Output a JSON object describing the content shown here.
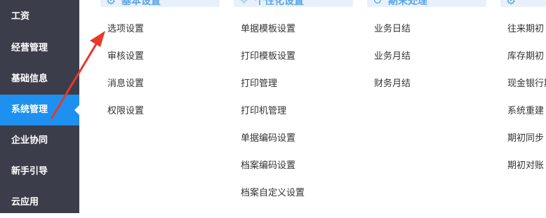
{
  "sidebar": {
    "items": [
      {
        "label": "工资"
      },
      {
        "label": "经营管理"
      },
      {
        "label": "基础信息"
      },
      {
        "label": "系统管理"
      },
      {
        "label": "企业协同"
      },
      {
        "label": "新手引导"
      },
      {
        "label": "云应用"
      }
    ],
    "active_index": 3
  },
  "columns": [
    {
      "header": "基本设置",
      "icon": "gear-icon",
      "items": [
        "选项设置",
        "审核设置",
        "消息设置",
        "权限设置"
      ]
    },
    {
      "header": "个性化设置",
      "icon": "star-icon",
      "items": [
        "单据模板设置",
        "打印模板设置",
        "打印管理",
        "打印机管理",
        "单据编码设置",
        "档案编码设置",
        "档案自定义设置"
      ]
    },
    {
      "header": "期末处理",
      "icon": "cycle-icon",
      "items": [
        "业务日结",
        "业务月结",
        "财务月结"
      ]
    },
    {
      "header": "",
      "icon": "gear-icon",
      "items": [
        "往来期初",
        "库存期初",
        "现金银行期初",
        "系统重建",
        "期初同步",
        "期初对账"
      ]
    }
  ],
  "colors": {
    "sidebar_bg": "#3b3d4a",
    "sidebar_active": "#1e90f0",
    "header_band": "#e8f1fb",
    "annotation_arrow": "#e8372b"
  }
}
